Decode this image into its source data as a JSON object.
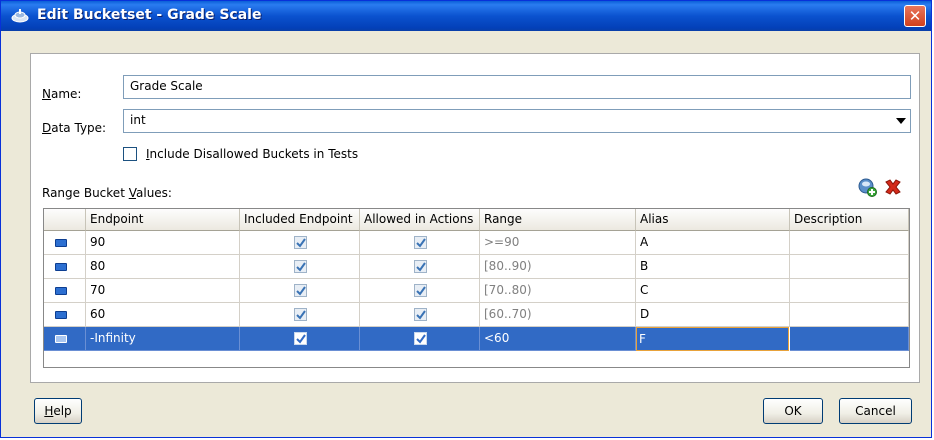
{
  "window": {
    "title": "Edit Bucketset - Grade Scale"
  },
  "form": {
    "name_label": "Name:",
    "name_value": "Grade Scale",
    "data_type_label": "Data Type:",
    "data_type_value": "int",
    "include_disallowed_label": "Include Disallowed Buckets in Tests",
    "include_disallowed_checked": false,
    "range_values_label": "Range Bucket Values:"
  },
  "table": {
    "columns": [
      "Endpoint",
      "Included Endpoint",
      "Allowed in Actions",
      "Range",
      "Alias",
      "Description"
    ],
    "rows": [
      {
        "endpoint": "90",
        "included": true,
        "allowed": true,
        "range": ">=90",
        "alias": "A",
        "description": ""
      },
      {
        "endpoint": "80",
        "included": true,
        "allowed": true,
        "range": "[80..90)",
        "alias": "B",
        "description": ""
      },
      {
        "endpoint": "70",
        "included": true,
        "allowed": true,
        "range": "[70..80)",
        "alias": "C",
        "description": ""
      },
      {
        "endpoint": "60",
        "included": true,
        "allowed": true,
        "range": "[60..70)",
        "alias": "D",
        "description": ""
      },
      {
        "endpoint": "-Infinity",
        "included": true,
        "allowed": true,
        "range": "<60",
        "alias": "F",
        "description": ""
      }
    ],
    "selected_row": 4
  },
  "buttons": {
    "help": "Help",
    "ok": "OK",
    "cancel": "Cancel"
  },
  "icons": {
    "add": "add-bucket-icon",
    "delete": "delete-bucket-icon",
    "close": "close-icon"
  },
  "colors": {
    "title_bar": "#0b52cf",
    "selection": "#316ac5",
    "dialog_bg": "#ece9d8"
  }
}
